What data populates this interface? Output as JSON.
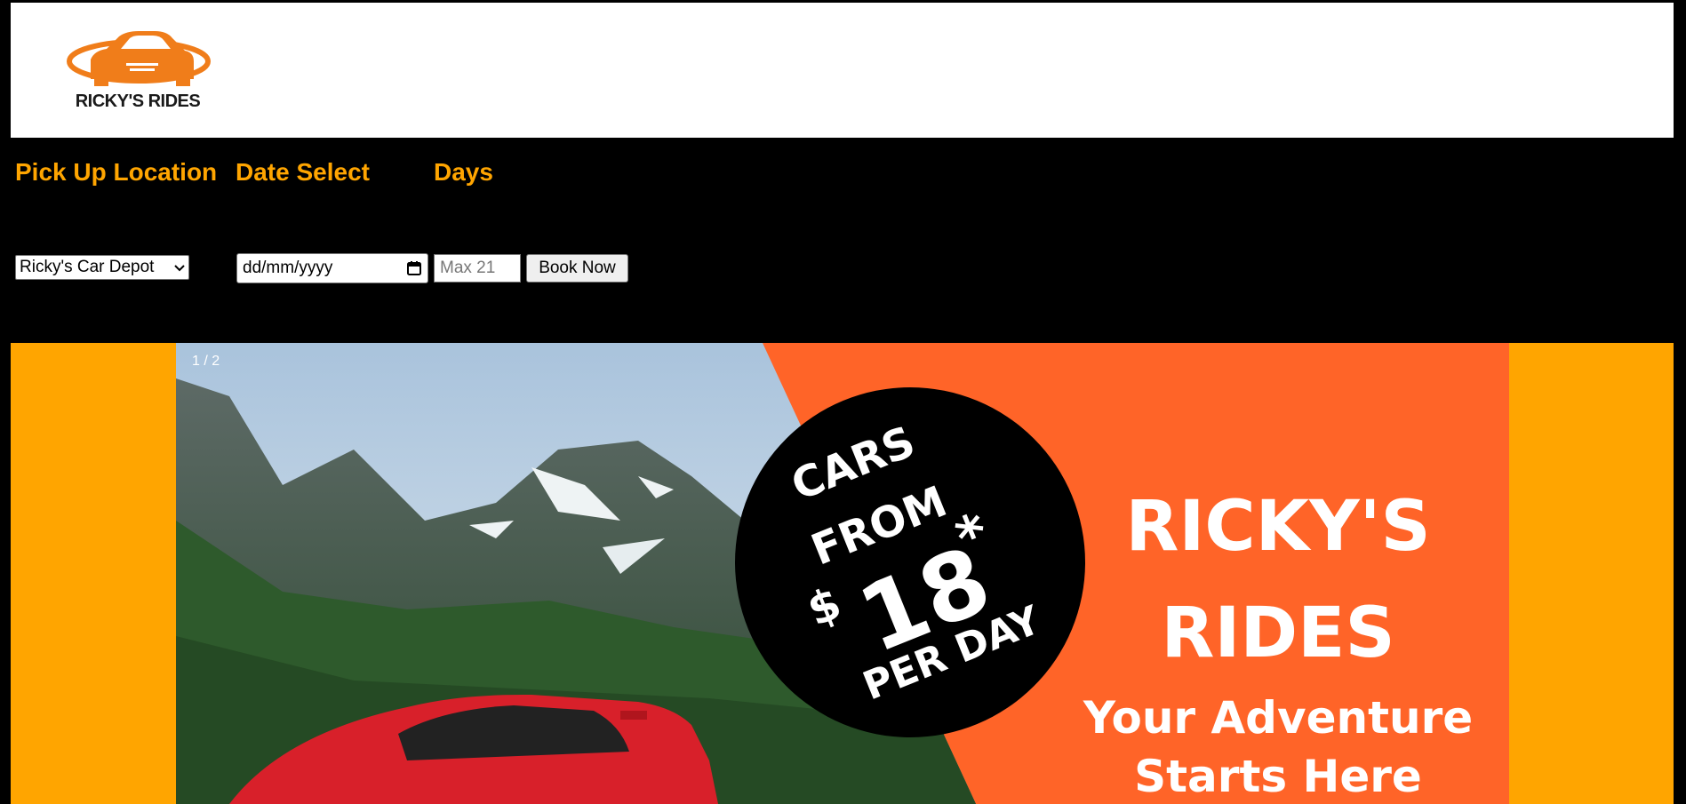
{
  "header": {
    "logo_text": "RICKY'S RIDES",
    "colors": {
      "background": "#ffffff",
      "logo_orange": "#f07d1a",
      "logo_text": "#1a1a1a"
    }
  },
  "booking_form": {
    "labels": {
      "pickup": "Pick Up Location",
      "date": "Date Select",
      "days": "Days"
    },
    "location_select": {
      "selected": "Ricky's Car Depot",
      "icon": "chevron-down-icon"
    },
    "date_input": {
      "value": "dd/mm/yyyy",
      "icon": "calendar-icon"
    },
    "days_input": {
      "placeholder": "Max 21"
    },
    "book_button": {
      "label": "Book Now"
    },
    "colors": {
      "label": "#ffa500",
      "background": "#000000"
    }
  },
  "hero": {
    "slide_counter": "1 / 2",
    "badge": {
      "line1": "CARS",
      "line2": "FROM",
      "currency": "$",
      "price": "18",
      "asterisk": "*",
      "line4": "PER DAY"
    },
    "title_line1": "RICKY'S",
    "title_line2": "RIDES",
    "tagline_line1": "Your Adventure",
    "tagline_line2": "Starts Here",
    "colors": {
      "frame": "#ffa500",
      "panel": "#ff6428",
      "badge": "#000000",
      "car": "#d8202a"
    }
  }
}
